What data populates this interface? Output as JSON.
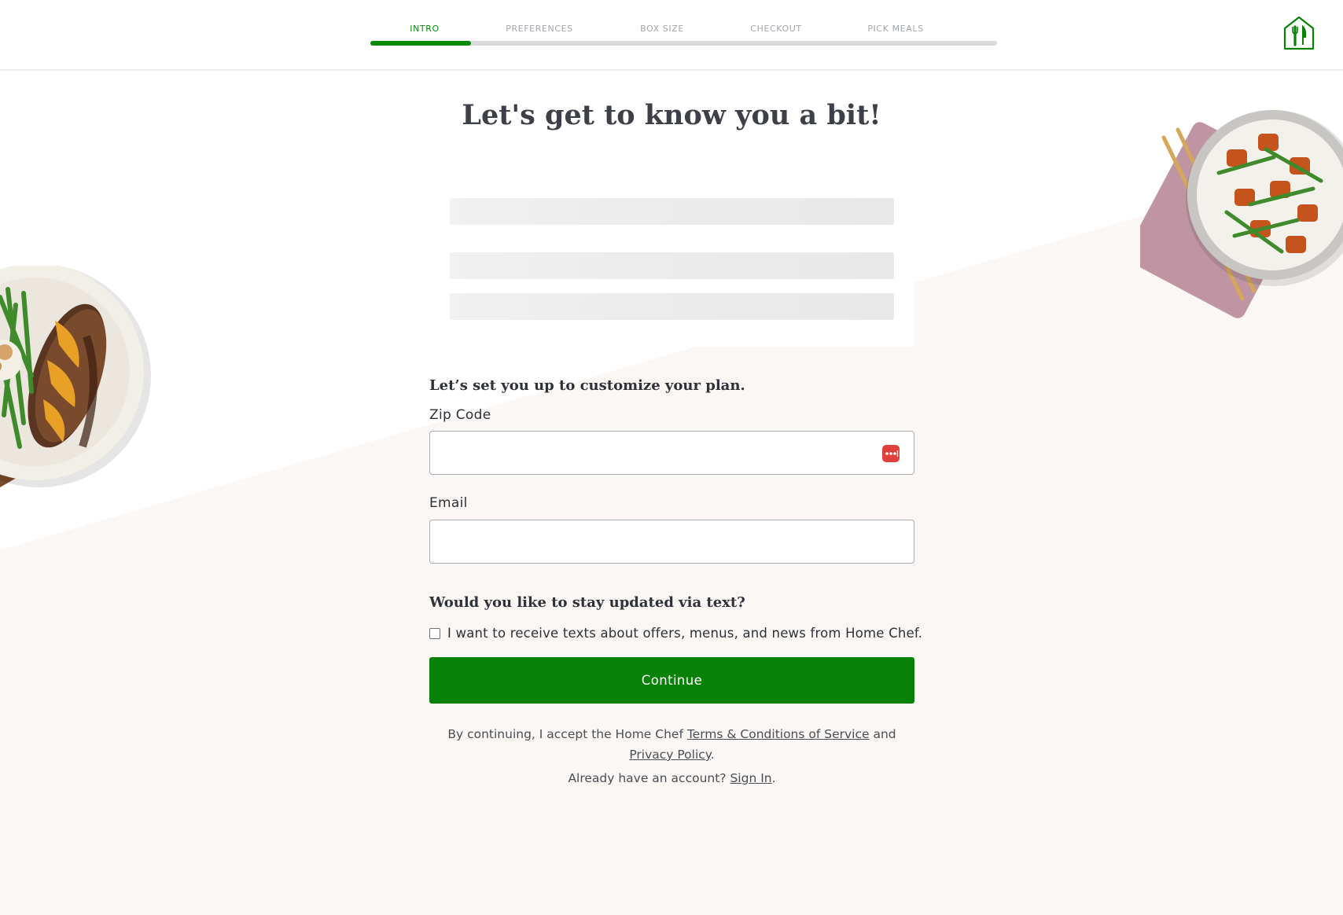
{
  "steps": [
    {
      "label": "INTRO",
      "active": true
    },
    {
      "label": "PREFERENCES",
      "active": false
    },
    {
      "label": "BOX SIZE",
      "active": false
    },
    {
      "label": "CHECKOUT",
      "active": false
    },
    {
      "label": "PICK MEALS",
      "active": false
    }
  ],
  "progress": 0.16,
  "title": "Let's get to know you a bit!",
  "setup_heading": "Let’s set you up to customize your plan.",
  "zip": {
    "label": "Zip Code",
    "value": ""
  },
  "email": {
    "label": "Email",
    "value": ""
  },
  "sms": {
    "heading": "Would you like to stay updated via text?",
    "checkbox_label": "I want to receive texts about offers, menus, and news from Home Chef.",
    "checked": false
  },
  "continue_label": "Continue",
  "legal": {
    "prefix": "By continuing, I accept the Home Chef ",
    "terms_link": "Terms & Conditions of Service",
    "middle": " and ",
    "privacy_link": "Privacy Policy",
    "suffix": "."
  },
  "signin": {
    "prefix": "Already have an account? ",
    "link": "Sign In",
    "suffix": "."
  },
  "colors": {
    "accent": "#078207",
    "background": "#fbf7f4",
    "password_icon": "#e0403a"
  }
}
